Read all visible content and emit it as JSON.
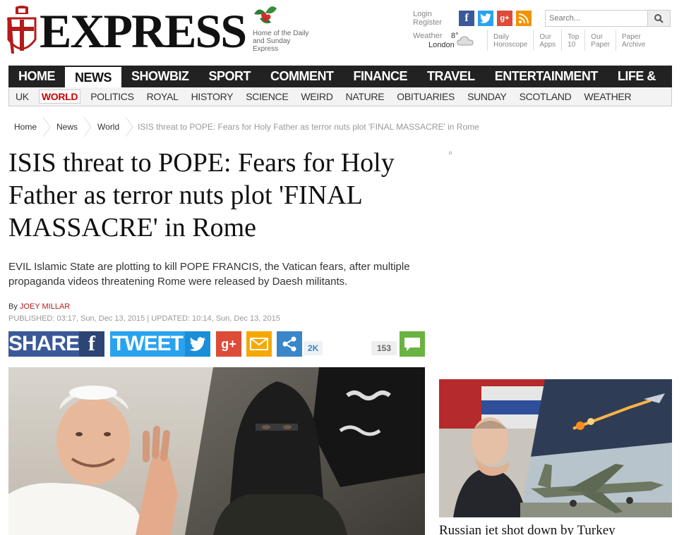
{
  "masthead": {
    "logo_text": "EXPRESS",
    "tagline": "Home of the Daily and Sunday Express",
    "login_label": "Login",
    "register_label": "Register",
    "search_placeholder": "Search...",
    "weather_label": "Weather",
    "weather_temp": "8°",
    "weather_location": "London",
    "social_icons": [
      "facebook-icon",
      "twitter-icon",
      "google-plus-icon",
      "rss-icon"
    ],
    "top_links": [
      {
        "line1": "Daily",
        "line2": "Horoscope"
      },
      {
        "line1": "Our",
        "line2": "Apps"
      },
      {
        "line1": "Top",
        "line2": "10"
      },
      {
        "line1": "Our",
        "line2": "Paper"
      },
      {
        "line1": "Paper",
        "line2": "Archive"
      }
    ]
  },
  "nav": {
    "main": [
      "HOME",
      "NEWS",
      "SHOWBIZ & TV",
      "SPORT",
      "COMMENT",
      "FINANCE",
      "TRAVEL",
      "ENTERTAINMENT",
      "LIFE & STYLE"
    ],
    "main_active": "NEWS",
    "sub": [
      "UK",
      "WORLD",
      "POLITICS",
      "ROYAL",
      "HISTORY",
      "SCIENCE",
      "WEIRD",
      "NATURE",
      "OBITUARIES",
      "SUNDAY",
      "SCOTLAND",
      "WEATHER"
    ],
    "sub_active": "WORLD"
  },
  "breadcrumb": {
    "items": [
      "Home",
      "News",
      "World"
    ],
    "current": "ISIS threat to POPE: Fears for Holy Father as terror nuts plot 'FINAL MASSACRE' in Rome"
  },
  "article": {
    "headline": "ISIS threat to POPE: Fears for Holy Father as terror nuts plot 'FINAL MASSACRE' in Rome",
    "standfirst": "EVIL Islamic State are plotting to kill POPE FRANCIS, the Vatican fears, after multiple propaganda videos threatening Rome were released by Daesh militants.",
    "byline_prefix": "By",
    "author": "JOEY MILLAR",
    "published": "PUBLISHED: 03:17, Sun, Dec 13, 2015 | UPDATED: 10:14, Sun, Dec 13, 2015"
  },
  "share": {
    "share_label": "SHARE",
    "tweet_label": "TWEET",
    "share_count": "2K",
    "comment_count": "153"
  },
  "sidebar": {
    "story_title": "Russian jet shot down by Turkey"
  },
  "colors": {
    "brand_red": "#c00000",
    "nav_bg": "#222222",
    "facebook": "#3b5998",
    "twitter": "#2aa3ef",
    "google_plus": "#dd4b39",
    "comment_green": "#69b341"
  }
}
